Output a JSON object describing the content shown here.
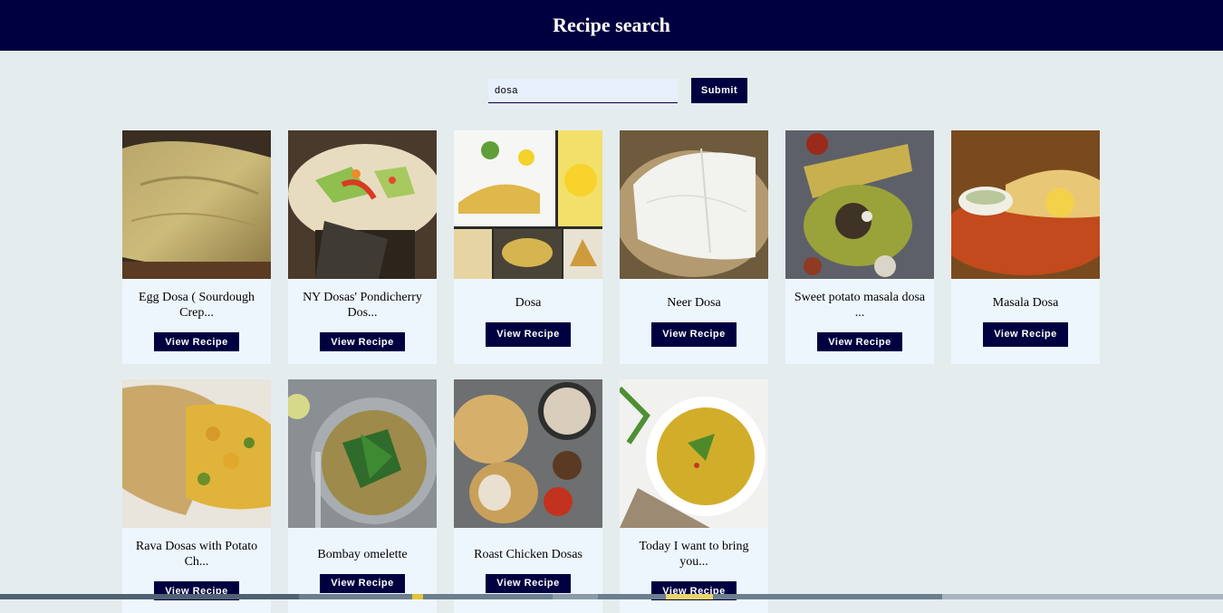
{
  "header": {
    "title": "Recipe search"
  },
  "search": {
    "value": "dosa",
    "submit_label": "Submit"
  },
  "cards": [
    {
      "title": "Egg Dosa ( Sourdough Crep...",
      "button": "View Recipe",
      "image": "egg-dosa-photo"
    },
    {
      "title": "NY Dosas' Pondicherry Dos...",
      "button": "View Recipe",
      "image": "pondicherry-dosa-photo"
    },
    {
      "title": "Dosa",
      "button": "View Recipe",
      "image": "masala-dosa-collage-photo"
    },
    {
      "title": "Neer Dosa",
      "button": "View Recipe",
      "image": "neer-dosa-photo"
    },
    {
      "title": "Sweet potato masala dosa ...",
      "button": "View Recipe",
      "image": "sweet-potato-dosa-photo"
    },
    {
      "title": "Masala Dosa",
      "button": "View Recipe",
      "image": "masala-dosa-photo"
    },
    {
      "title": "Rava Dosas with Potato Ch...",
      "button": "View Recipe",
      "image": "rava-dosa-photo"
    },
    {
      "title": "Bombay omelette",
      "button": "View Recipe",
      "image": "bombay-omelette-photo"
    },
    {
      "title": "Roast Chicken Dosas",
      "button": "View Recipe",
      "image": "roast-chicken-dosa-photo"
    },
    {
      "title": "Today I want to bring you...",
      "button": "View Recipe",
      "image": "dal-soup-photo"
    }
  ],
  "colors": {
    "header_bg": "#000040",
    "page_bg": "#e5ecee",
    "card_bg": "#eef6fd",
    "button_bg": "#000040"
  }
}
